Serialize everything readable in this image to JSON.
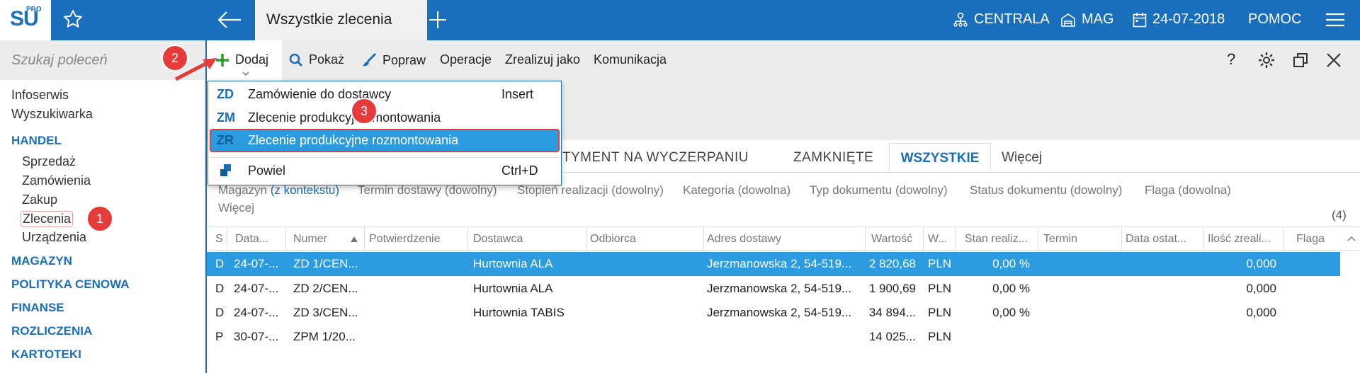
{
  "app": {
    "logo_text": "SU",
    "logo_sup": "PRO"
  },
  "topbar": {
    "active_tab": "Wszystkie zlecenia",
    "centrala": "CENTRALA",
    "mag": "MAG",
    "date": "24-07-2018",
    "help": "POMOC"
  },
  "sidebar": {
    "search_placeholder": "Szukaj poleceń",
    "items": [
      {
        "label": "Infoserwis"
      },
      {
        "label": "Wyszukiwarka"
      },
      {
        "label": "HANDEL"
      },
      {
        "label": "Sprzedaż"
      },
      {
        "label": "Zamówienia"
      },
      {
        "label": "Zakup"
      },
      {
        "label": "Zlecenia"
      },
      {
        "label": "Urządzenia"
      },
      {
        "label": "MAGAZYN"
      },
      {
        "label": "POLITYKA CENOWA"
      },
      {
        "label": "FINANSE"
      },
      {
        "label": "ROZLICZENIA"
      },
      {
        "label": "KARTOTEKI"
      }
    ]
  },
  "badges": {
    "b1": "1",
    "b2": "2",
    "b3": "3"
  },
  "toolbar": {
    "dodaj": "Dodaj",
    "pokaz": "Pokaż",
    "popraw": "Popraw",
    "operacje": "Operacje",
    "zrealizuj": "Zrealizuj jako",
    "komunikacja": "Komunikacja",
    "help": "?"
  },
  "dropdown": {
    "items": [
      {
        "code": "ZD",
        "label": "Zamówienie do dostawcy",
        "key": "Insert"
      },
      {
        "code": "ZM",
        "label": "Zlecenie produkcyjne montowania",
        "key": ""
      },
      {
        "code": "ZR",
        "label": "Zlecenie produkcyjne rozmontowania",
        "key": ""
      },
      {
        "code": "",
        "label": "Powiel",
        "key": "Ctrl+D"
      }
    ]
  },
  "tabs": {
    "partial": "RTYMENT NA WYCZERPANIU",
    "zamkniete": "ZAMKNIĘTE",
    "wszystkie": "WSZYSTKIE",
    "wiecej": "Więcej"
  },
  "filters": {
    "magazyn": "Magazyn",
    "magazyn_ctx": "(z kontekstu)",
    "termin": "Termin dostawy (dowolny)",
    "stopien": "Stopień realizacji (dowolny)",
    "kategoria": "Kategoria (dowolna)",
    "typ": "Typ dokumentu (dowolny)",
    "status": "Status dokumentu (dowolny)",
    "flaga": "Flaga (dowolna)",
    "wiecej": "Więcej",
    "count": "(4)"
  },
  "grid": {
    "headers": [
      "S",
      "Data...",
      "Numer",
      "Potwierdzenie",
      "Dostawca",
      "Odbiorca",
      "Adres dostawy",
      "Wartość",
      "W...",
      "Stan realiz...",
      "Termin",
      "Data ostat...",
      "Ilość zreali...",
      "Flaga"
    ],
    "rows": [
      {
        "s": "D",
        "data": "24-07-...",
        "numer": "ZD 1/CEN...",
        "potw": "",
        "dostawca": "Hurtownia ALA",
        "odbiorca": "",
        "adres": "Jerzmanowska 2, 54-519...",
        "wartosc": "2 820,68",
        "w": "PLN",
        "stan": "0,00 %",
        "termin": "",
        "dataost": "",
        "ilosc": "0,000",
        "flaga": ""
      },
      {
        "s": "D",
        "data": "24-07-...",
        "numer": "ZD 2/CEN...",
        "potw": "",
        "dostawca": "Hurtownia ALA",
        "odbiorca": "",
        "adres": "Jerzmanowska 2, 54-519...",
        "wartosc": "1 900,69",
        "w": "PLN",
        "stan": "0,00 %",
        "termin": "",
        "dataost": "",
        "ilosc": "0,000",
        "flaga": ""
      },
      {
        "s": "D",
        "data": "24-07-...",
        "numer": "ZD 3/CEN...",
        "potw": "",
        "dostawca": "Hurtownia TABIS",
        "odbiorca": "",
        "adres": "Jerzmanowska 2, 54-519...",
        "wartosc": "34 894...",
        "w": "PLN",
        "stan": "0,00 %",
        "termin": "",
        "dataost": "",
        "ilosc": "0,000",
        "flaga": ""
      },
      {
        "s": "P",
        "data": "30-07-...",
        "numer": "ZPM 1/20...",
        "potw": "",
        "dostawca": "",
        "odbiorca": "",
        "adres": "",
        "wartosc": "14 025...",
        "w": "PLN",
        "stan": "",
        "termin": "",
        "dataost": "",
        "ilosc": "",
        "flaga": ""
      }
    ]
  }
}
